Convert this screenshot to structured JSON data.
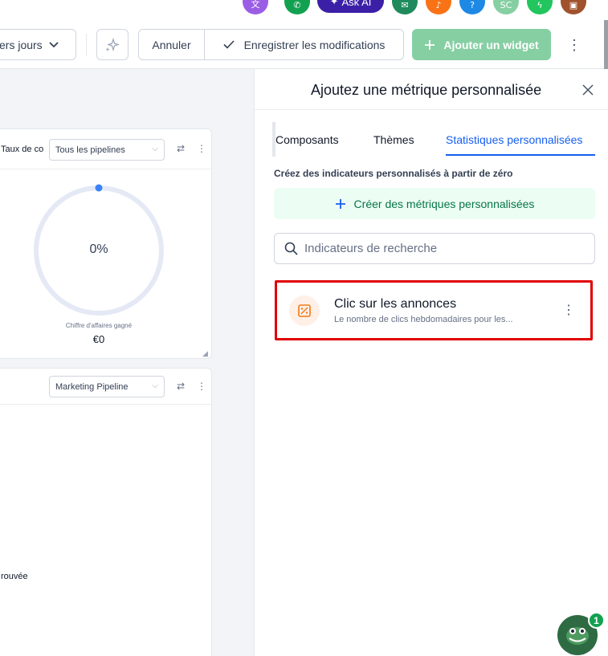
{
  "top_icons": {
    "ask_ai_label": "Ask AI",
    "avatar_initials": "SC",
    "help_glyph": "?"
  },
  "toolbar": {
    "date_range_label": "ers jours",
    "cancel_label": "Annuler",
    "save_label": "Enregistrer les modifications",
    "add_widget_label": "Ajouter un widget"
  },
  "widget1": {
    "title": "Taux de co",
    "pipeline_select": "Tous les pipelines",
    "percent": "0%",
    "caption": "Chiffre d'affaires gagné",
    "value": "€0",
    "progress_fraction": 0
  },
  "widget2": {
    "pipeline_select": "Marketing Pipeline",
    "empty_text": "rouvée"
  },
  "drawer": {
    "title": "Ajoutez une métrique personnalisée",
    "tabs": [
      {
        "label": "Composants"
      },
      {
        "label": "Thèmes"
      },
      {
        "label": "Statistiques personnalisées"
      }
    ],
    "active_tab": "Statistiques personnalisées",
    "section_caption": "Créez des indicateurs personnalisés à partir de zéro",
    "create_button": "Créer des métriques personnalisées",
    "search_placeholder": "Indicateurs de recherche",
    "metrics": [
      {
        "name": "Clic sur les annonces",
        "description": "Le nombre de clics hebdomadaires pour les..."
      }
    ]
  },
  "chat": {
    "badge_count": "1"
  },
  "colors": {
    "accent_blue": "#155eef",
    "add_widget_green": "#86cfa3",
    "create_green": "#067647",
    "highlight_red": "#e00000",
    "metric_icon_orange": "#f27a1a"
  }
}
